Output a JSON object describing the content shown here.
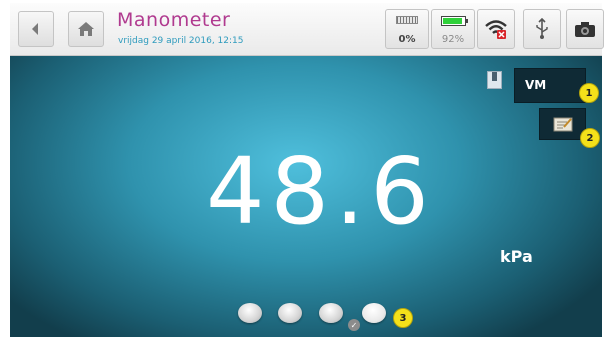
{
  "header": {
    "back_icon": "arrow-left-icon",
    "home_icon": "home-icon",
    "title": "Manometer",
    "datetime": "vrijdag 29 april 2016, 12:15"
  },
  "status": {
    "memory_value": "0%",
    "battery_value": "92%",
    "battery_fraction": 0.92,
    "battery_color": "#2fd13a",
    "wifi_icon": "wifi-disconnected-icon",
    "usb_icon": "usb-icon",
    "camera_icon": "camera-icon"
  },
  "display": {
    "reading": "48.6",
    "unit": "kPa",
    "mode_label": "VM",
    "bookmark_icon": "bookmark-icon",
    "note_icon": "notepad-icon"
  },
  "pages": {
    "count": 4,
    "active_index": 3
  },
  "callouts": [
    "1",
    "2",
    "3"
  ],
  "colors": {
    "title": "#b03a8f",
    "datetime": "#2e9bbd",
    "badge": "#f4e11a",
    "background": "#2f92ad"
  }
}
